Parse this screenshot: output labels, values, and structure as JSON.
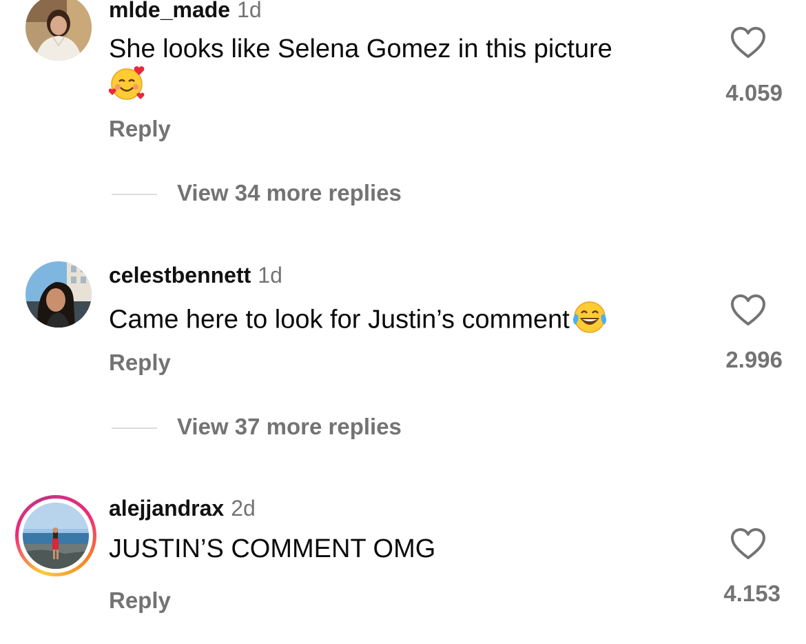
{
  "comments": [
    {
      "username": "mlde_made",
      "time": "1d",
      "text_line1": "She looks like Selena Gomez in this picture",
      "emoji": "smiling-face-with-hearts",
      "reply_label": "Reply",
      "like_count": "4.059",
      "view_replies": "View 34 more replies"
    },
    {
      "username": "celestbennett",
      "time": "1d",
      "text": "Came here to look for Justin’s comment",
      "emoji": "face-with-tears-of-joy",
      "reply_label": "Reply",
      "like_count": "2.996",
      "view_replies": "View 37 more replies"
    },
    {
      "username": "alejjandrax",
      "time": "2d",
      "text": "JUSTIN’S COMMENT OMG",
      "reply_label": "Reply",
      "like_count": "4.153"
    }
  ],
  "colors": {
    "secondary_text": "#737373",
    "primary_text": "#111111",
    "divider": "#dbdbdb",
    "story_ring": [
      "#f9ce34",
      "#ee2a7b",
      "#c13584"
    ]
  }
}
